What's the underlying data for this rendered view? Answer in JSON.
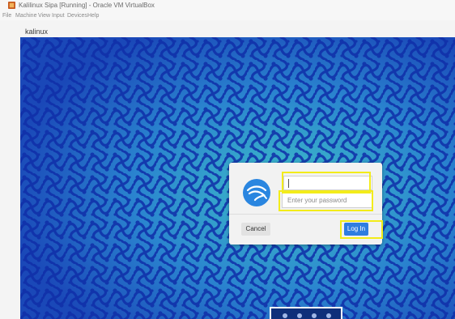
{
  "window": {
    "title": "Kalilinux Sipa [Running] - Oracle VM VirtualBox",
    "icon": "virtualbox-icon"
  },
  "menu": [
    {
      "label": "File"
    },
    {
      "label": "Machine"
    },
    {
      "label": "View"
    },
    {
      "label": "Input"
    },
    {
      "label": "Devices"
    },
    {
      "label": "Help"
    }
  ],
  "vm": {
    "label": "kalinux"
  },
  "login": {
    "logo_icon": "kali-dragon-icon",
    "username_value": "",
    "password_placeholder": "Enter your password",
    "cancel_label": "Cancel",
    "login_label": "Log In"
  },
  "colors": {
    "wallpaper_base": "#1a56c0",
    "wallpaper_pattern": "#2fa0b8",
    "login_button": "#2f7de1",
    "highlight": "#f3ec1a"
  }
}
